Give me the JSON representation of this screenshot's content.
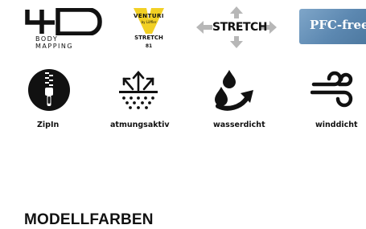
{
  "logos": {
    "body_mapping": {
      "mark": "4D",
      "line1": "BODY",
      "line2": "MAPPING"
    },
    "venturi": {
      "word": "VENTURI",
      "small": "by Löffler",
      "stretch": "STRETCH",
      "code": "81"
    },
    "stretch": {
      "word": "STRETCH"
    },
    "pfc": {
      "label": "PFC-free"
    }
  },
  "features": [
    {
      "id": "zipin",
      "label": "ZipIn",
      "icon": "zipper-icon"
    },
    {
      "id": "atmungsaktiv",
      "label": "atmungsaktiv",
      "icon": "breathable-icon"
    },
    {
      "id": "wasserdicht",
      "label": "wasserdicht",
      "icon": "waterproof-icon"
    },
    {
      "id": "winddicht",
      "label": "winddicht",
      "icon": "windproof-icon"
    }
  ],
  "section": {
    "title": "MODELLFARBEN"
  },
  "colors": {
    "venturi_yellow": "#f2d024",
    "pfc_blue": "#5c88b1",
    "arrow_gray": "#b7b7b7",
    "ink": "#111111"
  }
}
